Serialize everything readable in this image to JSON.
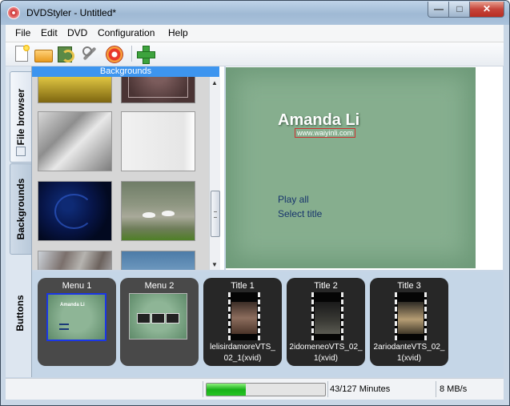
{
  "window": {
    "title": "DVDStyler - Untitled*"
  },
  "window_controls": {
    "minimize": "—",
    "maximize": "□",
    "close": "✕"
  },
  "menubar": [
    "File",
    "Edit",
    "DVD",
    "Configuration",
    "Help"
  ],
  "toolbar": {
    "icons": [
      "new-icon",
      "open-icon",
      "save-icon",
      "settings-icon",
      "burn-icon",
      "add-icon"
    ]
  },
  "side_tabs": {
    "file_browser": "File browser",
    "backgrounds": "Backgrounds",
    "buttons": "Buttons"
  },
  "browser": {
    "header": "Backgrounds",
    "thumbnails": [
      "gold",
      "dark-red",
      "silver",
      "white",
      "blue",
      "swans",
      "bark",
      "sky"
    ]
  },
  "preview": {
    "title": "Amanda Li",
    "url": "www.waiyinli.com",
    "buttons": [
      "Play all",
      "Select title"
    ],
    "background_color": "#6e9a79"
  },
  "titleset": [
    {
      "label": "Menu 1",
      "kind": "menu",
      "selected": true
    },
    {
      "label": "Menu 2",
      "kind": "menu"
    },
    {
      "label": "Title 1",
      "kind": "title",
      "caption_line1": "lelisirdamoreVTS_",
      "caption_line2": "02_1(xvid)"
    },
    {
      "label": "Title 2",
      "kind": "title",
      "caption_line1": "2idomeneoVTS_02_",
      "caption_line2": "1(xvid)"
    },
    {
      "label": "Title 3",
      "kind": "title",
      "caption_line1": "2ariodanteVTS_02_",
      "caption_line2": "1(xvid)"
    }
  ],
  "status": {
    "progress_fraction": 0.33,
    "duration": "43/127 Minutes",
    "rate": "8 MB/s",
    "accent_color": "#25c521"
  }
}
